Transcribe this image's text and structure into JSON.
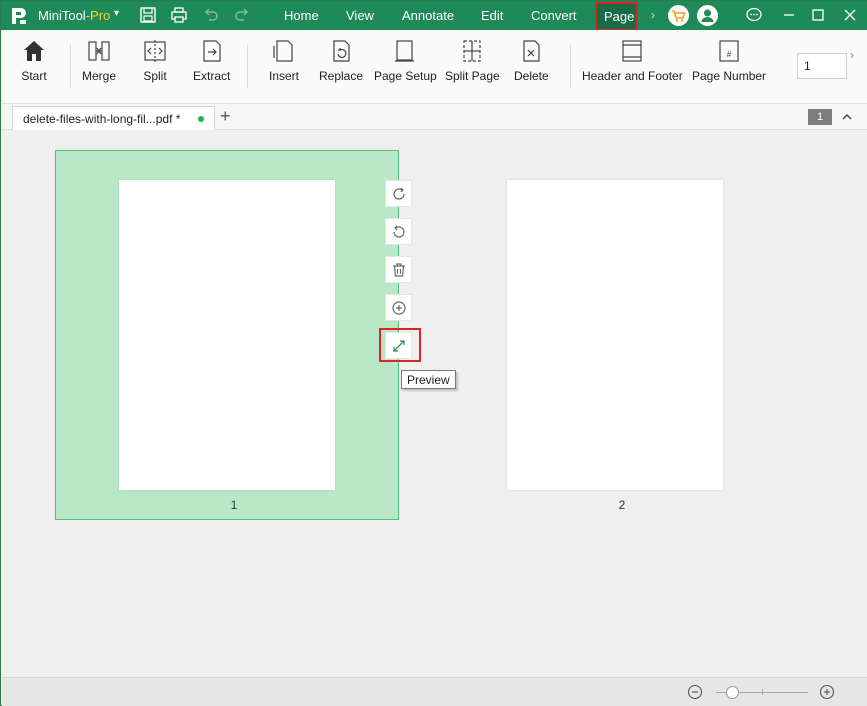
{
  "titlebar": {
    "app_name": "MiniTool",
    "app_suffix": "-Pro",
    "dropdown_glyph": "▾",
    "menu": [
      "Home",
      "View",
      "Annotate",
      "Edit",
      "Convert"
    ],
    "active_menu": "Page",
    "more_glyph": "›"
  },
  "toolbar": {
    "start": "Start",
    "merge": "Merge",
    "split": "Split",
    "extract": "Extract",
    "insert": "Insert",
    "replace": "Replace",
    "page_setup": "Page Setup",
    "split_page": "Split Page",
    "delete": "Delete",
    "header_footer": "Header and Footer",
    "page_number": "Page Number",
    "page_number_icon_text": "#",
    "page_input_value": "1",
    "more_glyph": "›"
  },
  "tabs": {
    "doc_name": "delete-files-with-long-fil...pdf *",
    "add_glyph": "+",
    "page_badge": "1"
  },
  "pages": {
    "page1_label": "1",
    "page2_label": "2"
  },
  "page_actions": {
    "tooltip": "Preview"
  },
  "colors": {
    "brand_green": "#1e8a57",
    "selection_fill": "#b9e8c8",
    "highlight_red": "#e02424"
  }
}
